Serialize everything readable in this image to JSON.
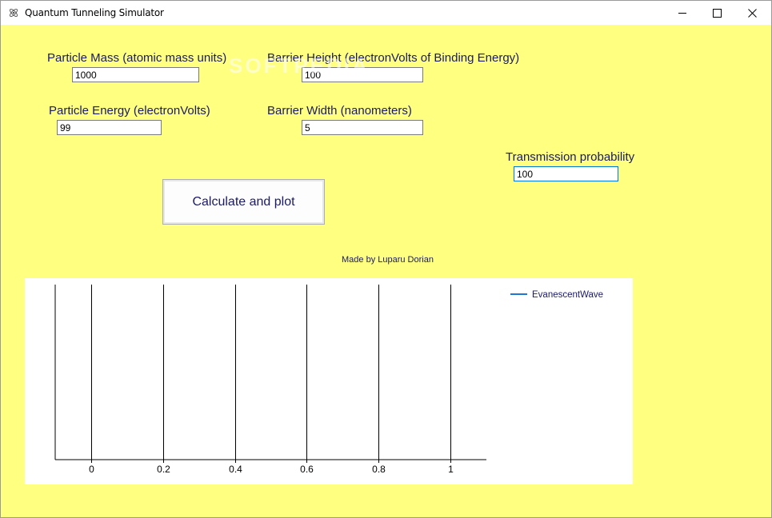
{
  "window": {
    "title": "Quantum Tunneling Simulator"
  },
  "form": {
    "mass_label": "Particle Mass (atomic mass units)",
    "mass_value": "1000",
    "barrier_height_label": "Barrier Height (electronVolts of Binding Energy)",
    "barrier_height_value": "100",
    "energy_label": "Particle Energy (electronVolts)",
    "energy_value": "99",
    "barrier_width_label": "Barrier Width (nanometers)",
    "barrier_width_value": "5",
    "transmission_label": "Transmission probability",
    "transmission_value": "100",
    "calculate_label": "Calculate and plot",
    "credit": "Made by Luparu Dorian"
  },
  "watermark": "SOFTPEDIA",
  "chart_data": {
    "type": "line",
    "x_ticks": [
      "0",
      "0.2",
      "0.4",
      "0.6",
      "0.8",
      "1"
    ],
    "x_tick_values": [
      0,
      0.2,
      0.4,
      0.6,
      0.8,
      1
    ],
    "xlim": [
      -0.1,
      1.1
    ],
    "grid": "vertical",
    "legend_position": "right",
    "series": [
      {
        "name": "EvanescentWave",
        "color": "#1f77d4",
        "values": []
      }
    ]
  }
}
